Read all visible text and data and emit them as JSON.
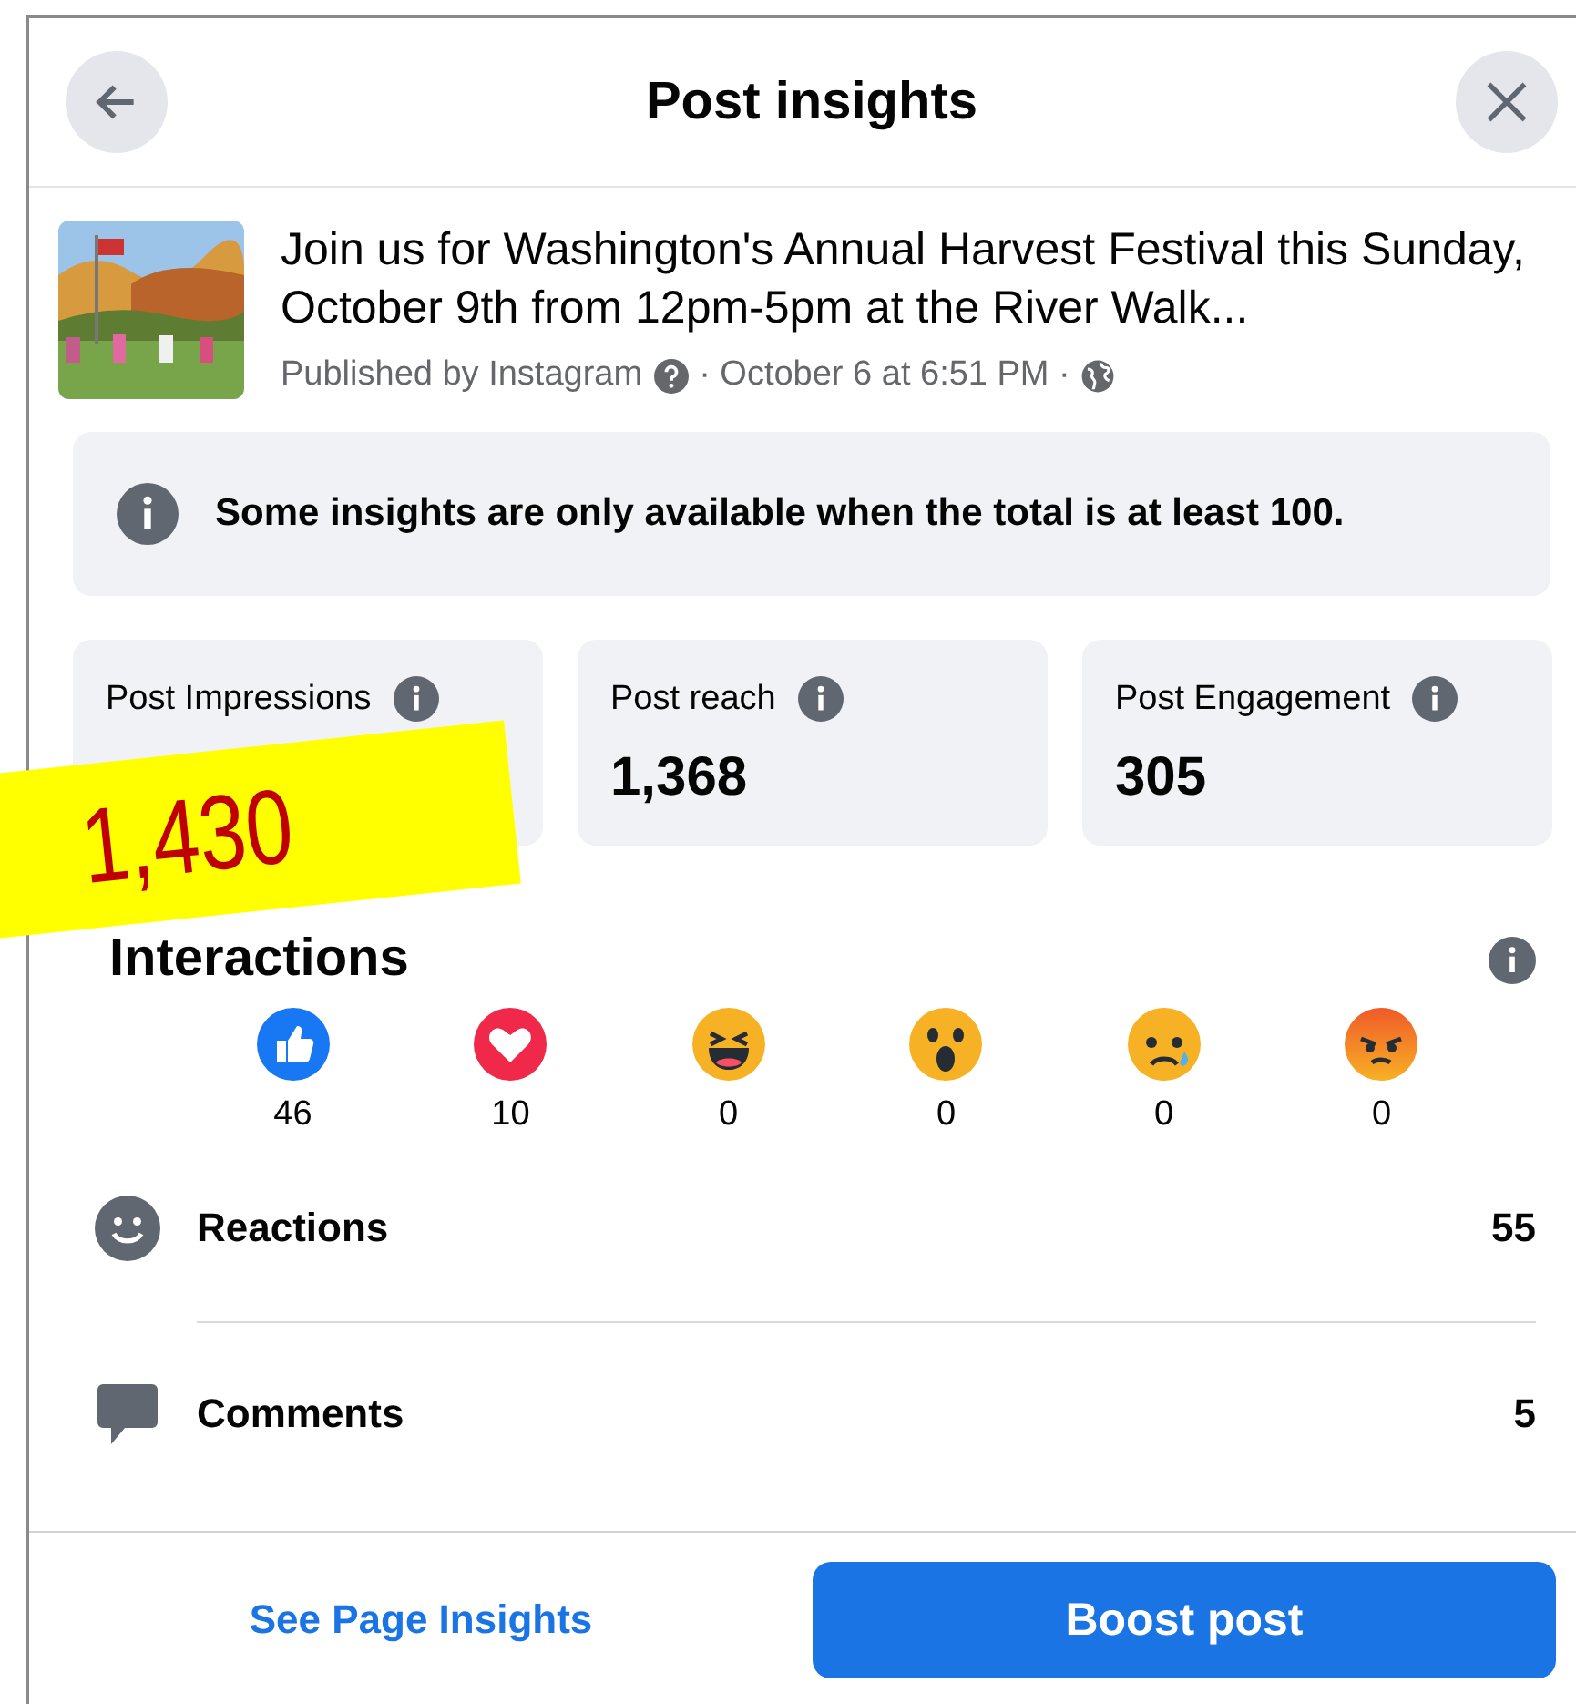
{
  "header": {
    "title": "Post insights"
  },
  "post": {
    "text": "Join us for Washington's Annual Harvest Festival this Sunday, October 9th from 12pm-5pm at the River Walk...",
    "publisher": "Published by Instagram",
    "date": "· October 6 at 6:51 PM ·"
  },
  "notice": "Some insights are only available when the total is at least 100.",
  "stats": [
    {
      "label": "Post Impressions"
    },
    {
      "label": "Post reach",
      "value": "1,368"
    },
    {
      "label": "Post Engagement",
      "value": "305"
    }
  ],
  "annotation": "1,430",
  "interactions": {
    "title": "Interactions",
    "reactions": [
      {
        "kind": "like",
        "count": "46"
      },
      {
        "kind": "love",
        "count": "10"
      },
      {
        "kind": "haha",
        "count": "0"
      },
      {
        "kind": "wow",
        "count": "0"
      },
      {
        "kind": "sad",
        "count": "0"
      },
      {
        "kind": "angry",
        "count": "0"
      }
    ],
    "rows": [
      {
        "kind": "reactions",
        "label": "Reactions",
        "value": "55"
      },
      {
        "kind": "comments",
        "label": "Comments",
        "value": "5"
      }
    ]
  },
  "footer": {
    "link": "See Page Insights",
    "button": "Boost post"
  }
}
